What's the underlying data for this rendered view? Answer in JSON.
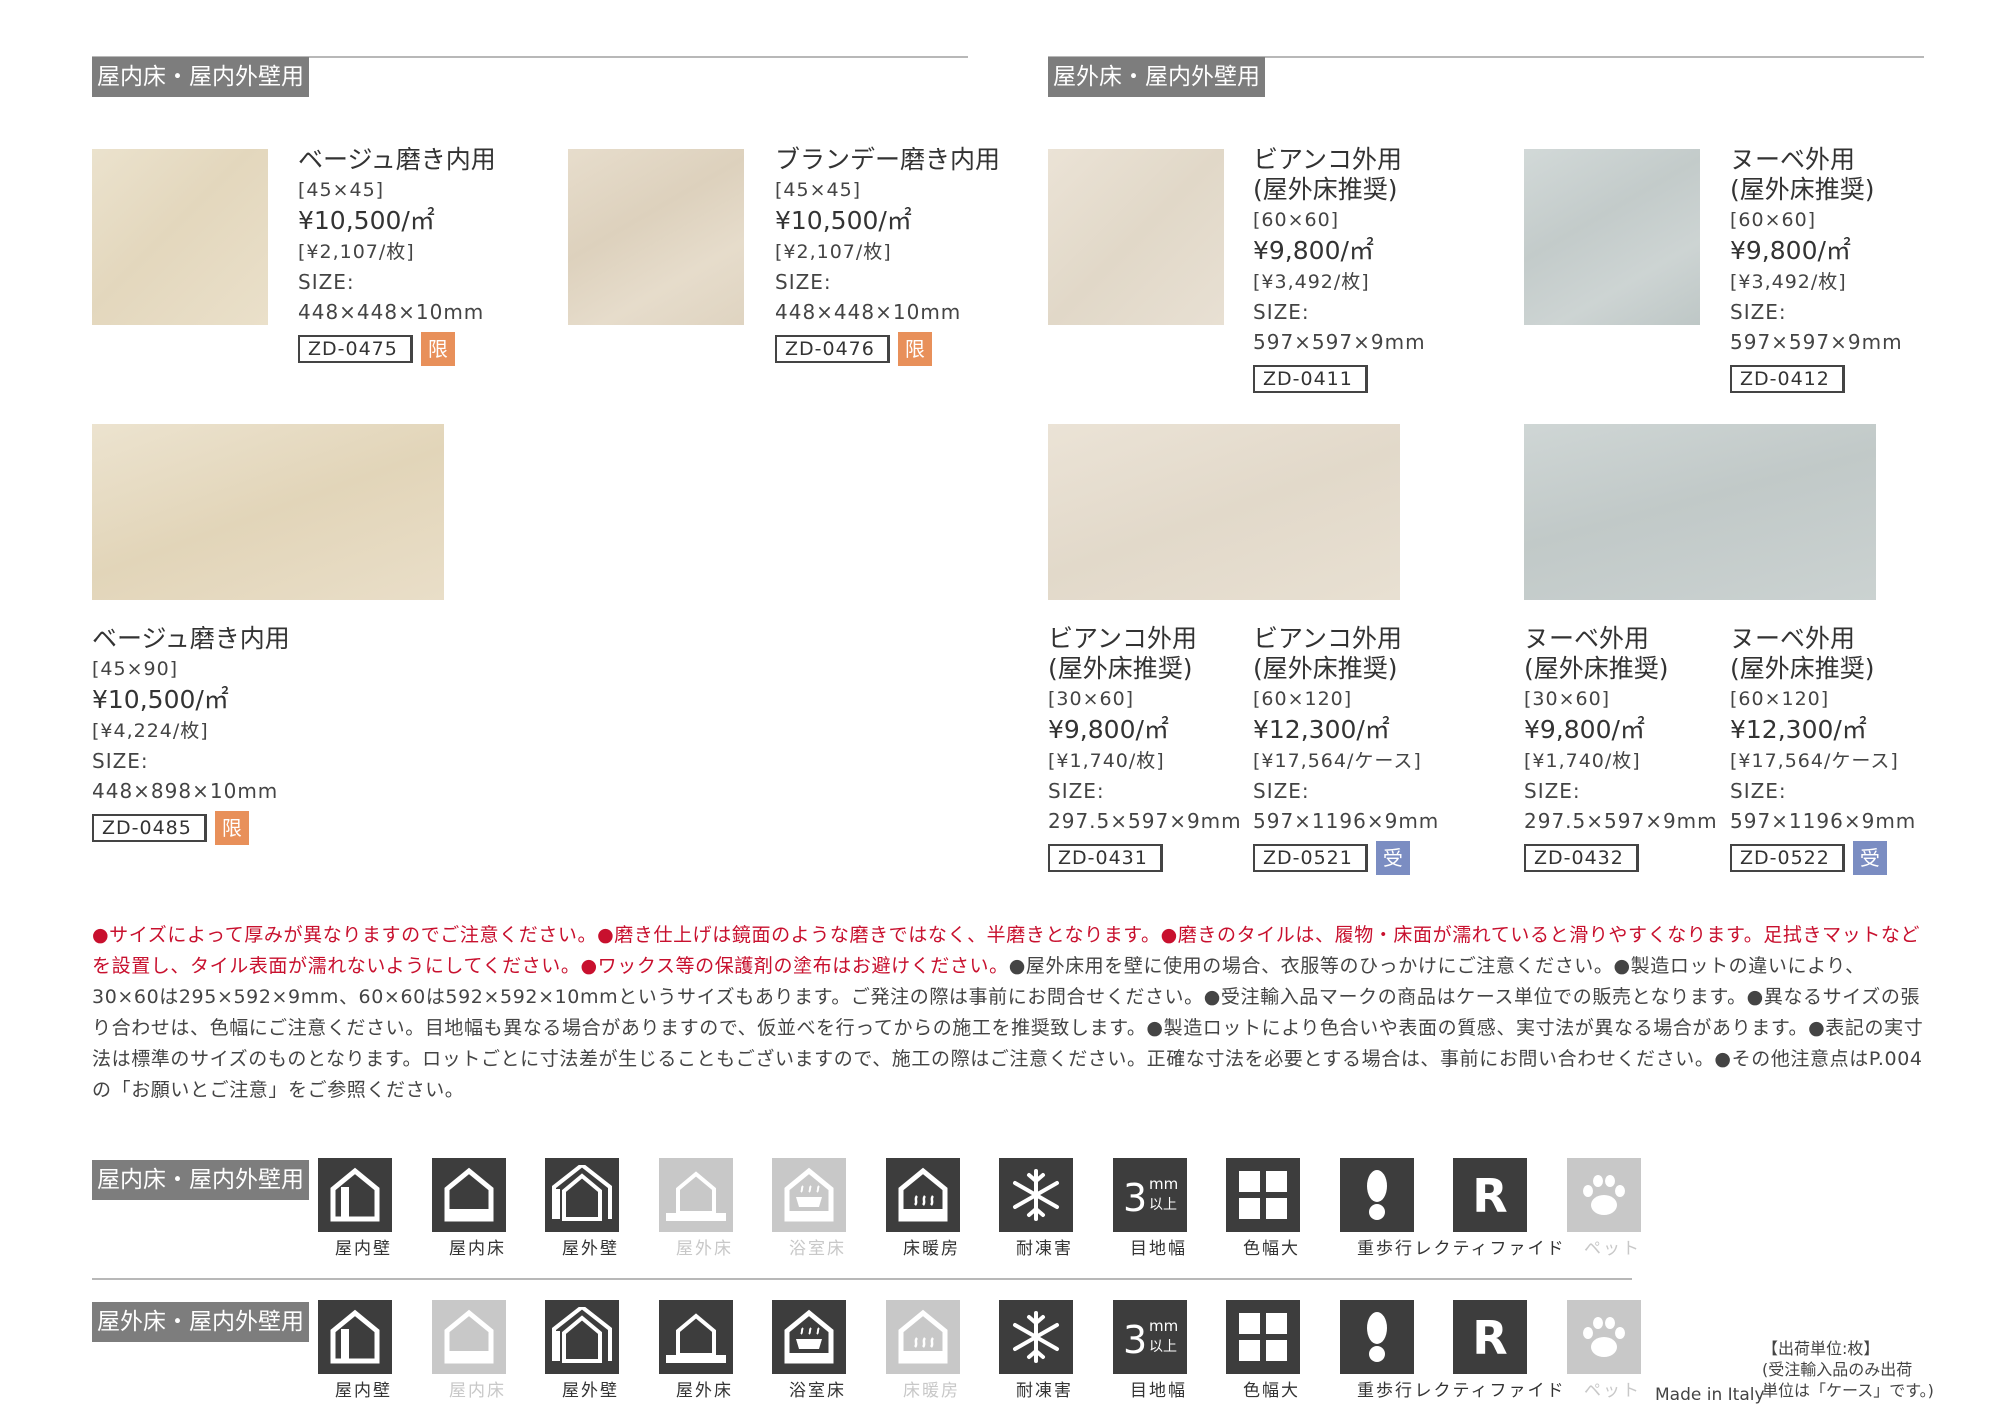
{
  "sections": {
    "left_label": "屋内床・屋内外壁用",
    "right_label": "屋外床・屋内外壁用"
  },
  "products": [
    {
      "name_line1": "ベージュ磨き内用",
      "name_line2": "",
      "grid": "[45×45]",
      "price": "¥10,500/㎡",
      "piece_price": "[¥2,107/枚]",
      "size_label": "SIZE:",
      "size": "448×448×10mm",
      "code": "ZD-0475",
      "badge": "限"
    },
    {
      "name_line1": "ブランデー磨き内用",
      "name_line2": "",
      "grid": "[45×45]",
      "price": "¥10,500/㎡",
      "piece_price": "[¥2,107/枚]",
      "size_label": "SIZE:",
      "size": "448×448×10mm",
      "code": "ZD-0476",
      "badge": "限"
    },
    {
      "name_line1": "ベージュ磨き内用",
      "name_line2": "",
      "grid": "[45×90]",
      "price": "¥10,500/㎡",
      "piece_price": "[¥4,224/枚]",
      "size_label": "SIZE:",
      "size": "448×898×10mm",
      "code": "ZD-0485",
      "badge": "限"
    },
    {
      "name_line1": "ビアンコ外用",
      "name_line2": "(屋外床推奨)",
      "grid": "[60×60]",
      "price": "¥9,800/㎡",
      "piece_price": "[¥3,492/枚]",
      "size_label": "SIZE:",
      "size": "597×597×9mm",
      "code": "ZD-0411",
      "badge": ""
    },
    {
      "name_line1": "ヌーベ外用",
      "name_line2": "(屋外床推奨)",
      "grid": "[60×60]",
      "price": "¥9,800/㎡",
      "piece_price": "[¥3,492/枚]",
      "size_label": "SIZE:",
      "size": "597×597×9mm",
      "code": "ZD-0412",
      "badge": ""
    },
    {
      "name_line1": "ビアンコ外用",
      "name_line2": "(屋外床推奨)",
      "grid": "[30×60]",
      "price": "¥9,800/㎡",
      "piece_price": "[¥1,740/枚]",
      "size_label": "SIZE:",
      "size": "297.5×597×9mm",
      "code": "ZD-0431",
      "badge": ""
    },
    {
      "name_line1": "ビアンコ外用",
      "name_line2": "(屋外床推奨)",
      "grid": "[60×120]",
      "price": "¥12,300/㎡",
      "piece_price": "[¥17,564/ケース]",
      "size_label": "SIZE:",
      "size": "597×1196×9mm",
      "code": "ZD-0521",
      "badge": "受"
    },
    {
      "name_line1": "ヌーベ外用",
      "name_line2": "(屋外床推奨)",
      "grid": "[30×60]",
      "price": "¥9,800/㎡",
      "piece_price": "[¥1,740/枚]",
      "size_label": "SIZE:",
      "size": "297.5×597×9mm",
      "code": "ZD-0432",
      "badge": ""
    },
    {
      "name_line1": "ヌーベ外用",
      "name_line2": "(屋外床推奨)",
      "grid": "[60×120]",
      "price": "¥12,300/㎡",
      "piece_price": "[¥17,564/ケース]",
      "size_label": "SIZE:",
      "size": "597×1196×9mm",
      "code": "ZD-0522",
      "badge": "受"
    }
  ],
  "colors": {
    "beige": "#e8ddc7",
    "brandy": "#e2d7c6",
    "bianco": "#e6ddcf",
    "nuvola": "#c9d1d0",
    "badge_limited": "#e8905a",
    "badge_order": "#7b8dc2",
    "note_red": "#c8102e"
  },
  "notes": {
    "red_1": "●サイズによって厚みが異なりますのでご注意ください。",
    "red_2": "●磨き仕上げは鏡面のような磨きではなく、半磨きとなります。",
    "red_3": "●磨きのタイルは、履物・床面が濡れていると滑りやすくなります。足拭きマットなどを設置し、タイル表面が濡れないようにしてください。",
    "red_4": "●ワックス等の保護剤の塗布はお避けください。",
    "dark": "●屋外床用を壁に使用の場合、衣服等のひっかけにご注意ください。●製造ロットの違いにより、30×60は295×592×9mm、60×60は592×592×10mmというサイズもあります。ご発注の際は事前にお問合せください。●受注輸入品マークの商品はケース単位での販売となります。●異なるサイズの張り合わせは、色幅にご注意ください。目地幅も異なる場合がありますので、仮並べを行ってからの施工を推奨致します。●製造ロットにより色合いや表面の質感、実寸法が異なる場合があります。●表記の実寸法は標準のサイズのものとなります。ロットごとに寸法差が生じることもございますので、施工の際はご注意ください。正確な寸法を必要とする場合は、事前にお問い合わせください。●その他注意点はP.004の「お願いとご注意」をご参照ください。"
  },
  "icon_rows": [
    {
      "label": "屋内床・屋内外壁用",
      "icons": [
        {
          "label": "屋内壁",
          "icon": "indoor-wall-icon",
          "on": true
        },
        {
          "label": "屋内床",
          "icon": "indoor-floor-icon",
          "on": true
        },
        {
          "label": "屋外壁",
          "icon": "outdoor-wall-icon",
          "on": true
        },
        {
          "label": "屋外床",
          "icon": "outdoor-floor-icon",
          "on": false
        },
        {
          "label": "浴室床",
          "icon": "bathroom-floor-icon",
          "on": false
        },
        {
          "label": "床暖房",
          "icon": "floor-heating-icon",
          "on": true
        },
        {
          "label": "耐凍害",
          "icon": "frost-resistant-icon",
          "on": true
        },
        {
          "label": "目地幅",
          "icon": "joint-width-icon",
          "on": true
        },
        {
          "label": "色幅大",
          "icon": "color-variation-icon",
          "on": true
        },
        {
          "label": "重歩行",
          "icon": "heavy-traffic-icon",
          "on": true
        },
        {
          "label": "レクティファイド",
          "icon": "rectified-icon",
          "on": true
        },
        {
          "label": "ペット",
          "icon": "pet-icon",
          "on": false
        }
      ]
    },
    {
      "label": "屋外床・屋内外壁用",
      "icons": [
        {
          "label": "屋内壁",
          "icon": "indoor-wall-icon",
          "on": true
        },
        {
          "label": "屋内床",
          "icon": "indoor-floor-icon",
          "on": false
        },
        {
          "label": "屋外壁",
          "icon": "outdoor-wall-icon",
          "on": true
        },
        {
          "label": "屋外床",
          "icon": "outdoor-floor-icon",
          "on": true
        },
        {
          "label": "浴室床",
          "icon": "bathroom-floor-icon",
          "on": true
        },
        {
          "label": "床暖房",
          "icon": "floor-heating-icon",
          "on": false
        },
        {
          "label": "耐凍害",
          "icon": "frost-resistant-icon",
          "on": true
        },
        {
          "label": "目地幅",
          "icon": "joint-width-icon",
          "on": true
        },
        {
          "label": "色幅大",
          "icon": "color-variation-icon",
          "on": true
        },
        {
          "label": "重歩行",
          "icon": "heavy-traffic-icon",
          "on": true
        },
        {
          "label": "レクティファイド",
          "icon": "rectified-icon",
          "on": true
        },
        {
          "label": "ペット",
          "icon": "pet-icon",
          "on": false
        }
      ]
    }
  ],
  "joint_icon_text": {
    "num": "3",
    "unit": "mm",
    "suffix": "以上"
  },
  "rectified_letter": "R",
  "footer": {
    "made_in": "Made in Italy",
    "unit_line1": "【出荷単位:枚】",
    "unit_line2": "(受注輸入品のみ出荷",
    "unit_line3": "単位は「ケース」です。)"
  }
}
